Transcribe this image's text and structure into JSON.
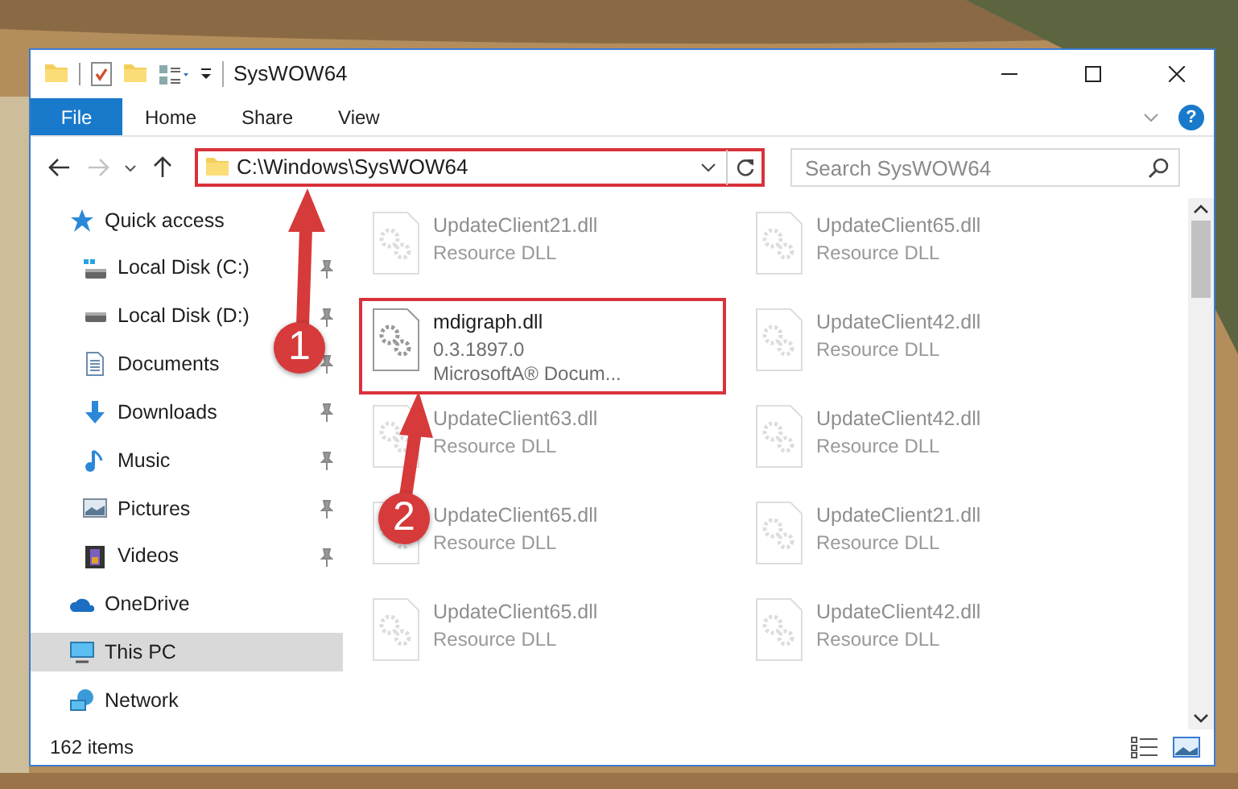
{
  "window": {
    "title": "SysWOW64"
  },
  "ribbon_tabs": [
    {
      "label": "File",
      "kind": "menu",
      "selected": false
    },
    {
      "label": "Home",
      "kind": "tab",
      "selected": false
    },
    {
      "label": "Share",
      "kind": "tab",
      "selected": false
    },
    {
      "label": "View",
      "kind": "tab",
      "selected": false
    }
  ],
  "help": "?",
  "navigation": {
    "forward_disabled": true
  },
  "address": {
    "path": "C:\\Windows\\SysWOW64",
    "highlighted": true
  },
  "search": {
    "placeholder": "Search SysWOW64"
  },
  "sidebar": {
    "items": [
      {
        "label": "Quick access",
        "kind": "star",
        "selected": false,
        "children": [
          {
            "label": "Local Disk (C:)",
            "kind": "system",
            "pinned": true,
            "selected": false
          },
          {
            "label": "Local Disk (D:)",
            "kind": "drive",
            "pinned": true,
            "selected": false
          },
          {
            "label": "Documents",
            "kind": "documents",
            "pinned": true,
            "selected": false
          },
          {
            "label": "Downloads",
            "kind": "downloads",
            "pinned": true,
            "selected": false
          },
          {
            "label": "Music",
            "kind": "music",
            "pinned": true,
            "selected": false
          },
          {
            "label": "Pictures",
            "kind": "pictures",
            "pinned": true,
            "selected": false
          },
          {
            "label": "Videos",
            "kind": "videos",
            "pinned": true,
            "selected": false
          }
        ]
      },
      {
        "label": "OneDrive",
        "kind": "cloud",
        "selected": false
      },
      {
        "label": "This PC",
        "kind": "computer",
        "selected": true
      },
      {
        "label": "Network",
        "kind": "network",
        "selected": false
      }
    ]
  },
  "files": {
    "columns": [
      [
        {
          "name": "UpdateClient21.dll",
          "details": [
            "Resource DLL"
          ],
          "blurred": true,
          "highlighted": false
        },
        {
          "name": "mdigraph.dll",
          "details": [
            "0.3.1897.0",
            "MicrosoftA® Docum..."
          ],
          "blurred": false,
          "highlighted": true
        },
        {
          "name": "UpdateClient63.dll",
          "details": [
            "Resource DLL"
          ],
          "blurred": true,
          "highlighted": false
        },
        {
          "name": "UpdateClient65.dll",
          "details": [
            "Resource DLL"
          ],
          "blurred": true,
          "highlighted": false
        },
        {
          "name": "UpdateClient65.dll",
          "details": [
            "Resource DLL"
          ],
          "blurred": true,
          "highlighted": false
        }
      ],
      [
        {
          "name": "UpdateClient65.dll",
          "details": [
            "Resource DLL"
          ],
          "blurred": true,
          "highlighted": false
        },
        {
          "name": "UpdateClient42.dll",
          "details": [
            "Resource DLL"
          ],
          "blurred": true,
          "highlighted": false
        },
        {
          "name": "UpdateClient42.dll",
          "details": [
            "Resource DLL"
          ],
          "blurred": true,
          "highlighted": false
        },
        {
          "name": "UpdateClient21.dll",
          "details": [
            "Resource DLL"
          ],
          "blurred": true,
          "highlighted": false
        },
        {
          "name": "UpdateClient42.dll",
          "details": [
            "Resource DLL"
          ],
          "blurred": true,
          "highlighted": false
        }
      ]
    ]
  },
  "status_bar": {
    "item_count": "162 items"
  },
  "annotations": [
    {
      "number": "1"
    },
    {
      "number": "2"
    }
  ]
}
